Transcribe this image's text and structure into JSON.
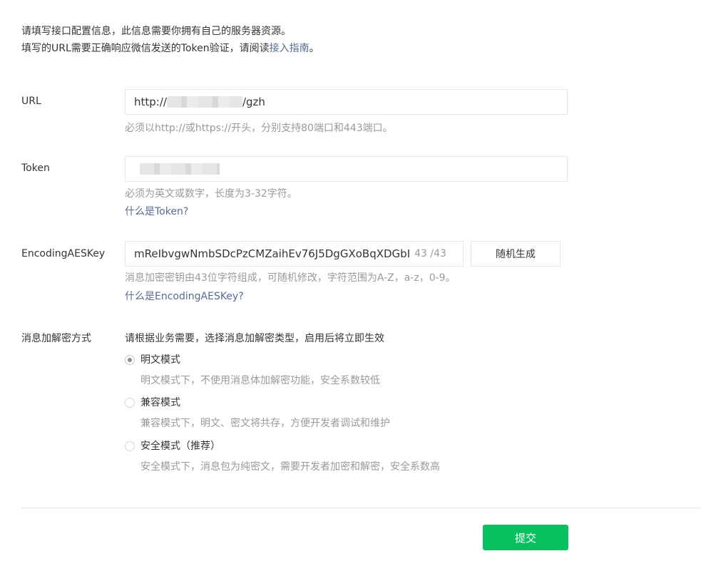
{
  "intro": {
    "line1": "请填写接口配置信息，此信息需要你拥有自己的服务器资源。",
    "line2_prefix": "填写的URL需要正确响应微信发送的Token验证，请阅读",
    "line2_link": "接入指南",
    "line2_suffix": "。"
  },
  "url": {
    "label": "URL",
    "value_prefix": "http://",
    "value_suffix": "/gzh",
    "hint": "必须以http://或https://开头，分别支持80端口和443端口。"
  },
  "token": {
    "label": "Token",
    "hint": "必须为英文或数字，长度为3-32字符。",
    "help_link": "什么是Token?"
  },
  "aes": {
    "label": "EncodingAESKey",
    "value": "mReIbvgwNmbSDcPzCMZaihEv76J5DgGXoBqXDGbI",
    "counter": "43 /43",
    "generate_label": "随机生成",
    "hint": "消息加密密钥由43位字符组成，可随机修改，字符范围为A-Z，a-z，0-9。",
    "help_link": "什么是EncodingAESKey?"
  },
  "encryption": {
    "label": "消息加解密方式",
    "description": "请根据业务需要，选择消息加解密类型，启用后将立即生效",
    "options": [
      {
        "label": "明文模式",
        "hint": "明文模式下，不使用消息体加解密功能，安全系数较低",
        "checked": true
      },
      {
        "label": "兼容模式",
        "hint": "兼容模式下，明文、密文将共存，方便开发者调试和维护",
        "checked": false
      },
      {
        "label": "安全模式（推荐）",
        "hint": "安全模式下，消息包为纯密文，需要开发者加密和解密，安全系数高",
        "checked": false
      }
    ]
  },
  "submit_label": "提交",
  "colors": {
    "primary_green": "#07c160",
    "link_blue": "#576b95",
    "hint_gray": "#9a9a9a"
  }
}
